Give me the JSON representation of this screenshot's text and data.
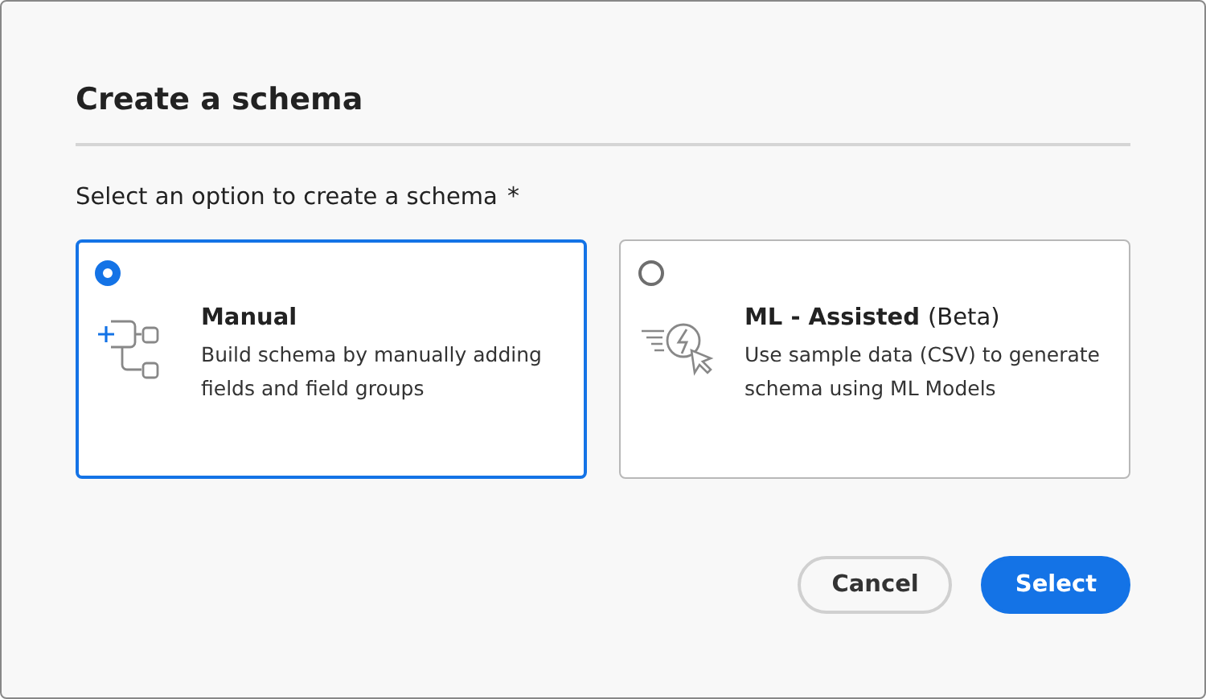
{
  "dialog": {
    "title": "Create a schema"
  },
  "prompt": {
    "label": "Select an option to create a schema",
    "required_mark": "*"
  },
  "options": [
    {
      "kind": "manual",
      "title": "Manual",
      "description": "Build schema by manually adding fields and field groups",
      "selected": true
    },
    {
      "kind": "ml",
      "title": "ML - Assisted",
      "suffix": "(Beta)",
      "description": "Use sample data (CSV) to generate schema using ML Models",
      "selected": false
    }
  ],
  "buttons": [
    {
      "label": "Cancel",
      "kind": "secondary"
    },
    {
      "label": "Select",
      "kind": "primary"
    }
  ]
}
